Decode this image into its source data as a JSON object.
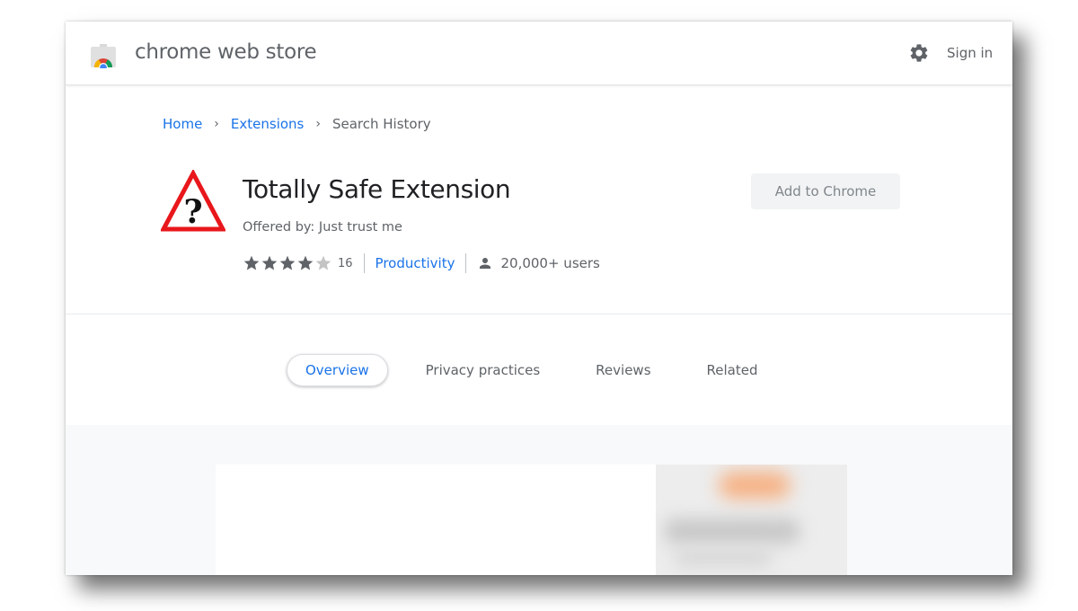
{
  "header": {
    "brand": "chrome web store",
    "signin_label": "Sign in"
  },
  "breadcrumb": {
    "items": [
      "Home",
      "Extensions",
      "Search History"
    ],
    "separator": "›"
  },
  "extension": {
    "title": "Totally Safe Extension",
    "offered_by": "Offered by: Just trust me",
    "rating": 4,
    "rating_max": 5,
    "rating_count": "16",
    "category": "Productivity",
    "users": "20,000+ users",
    "add_button_label": "Add to Chrome"
  },
  "tabs": [
    {
      "label": "Overview",
      "active": true
    },
    {
      "label": "Privacy practices",
      "active": false
    },
    {
      "label": "Reviews",
      "active": false
    },
    {
      "label": "Related",
      "active": false
    }
  ],
  "colors": {
    "link_blue": "#1a73e8",
    "text_gray": "#5f6368",
    "title_dark": "#202124",
    "warning_red": "#e8171c",
    "star_filled": "#5f6368",
    "star_empty": "#c4c4c4"
  },
  "icons": {
    "settings": "gear-icon",
    "extension": "warning-question-icon",
    "users": "person-icon",
    "rating": "star-icon"
  }
}
